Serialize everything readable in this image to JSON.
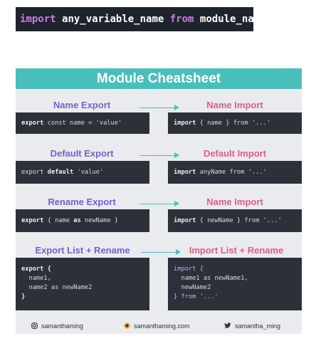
{
  "top_strip": {
    "kw1": "import",
    "var": "any_variable_name",
    "kw2": "from",
    "module": "module_name"
  },
  "sheet": {
    "title": "Module Cheatsheet",
    "rows": [
      {
        "export_label": "Name Export",
        "import_label": "Name Import",
        "export_code": [
          "export",
          " const name = 'value'"
        ],
        "import_code": [
          "import",
          " { name } from '...'"
        ]
      },
      {
        "export_label": "Default Export",
        "import_label": "Default Import",
        "export_code": [
          "export",
          " default",
          " 'value'"
        ],
        "import_code": [
          "import",
          " anyName from '...'"
        ]
      },
      {
        "export_label": "Rename Export",
        "import_label": "Name Import",
        "export_code": [
          "export",
          " { name ",
          "as",
          " newName }"
        ],
        "import_code": [
          "import",
          " { newName } from '...'"
        ]
      },
      {
        "export_label": "Export List + Rename",
        "import_label": "Import List + Rename",
        "export_lines": [
          "export {",
          "  name1,",
          "  name2 as newName2",
          "}"
        ],
        "import_lines": [
          "import {",
          "  name1 as newName1,",
          "  newName2",
          "} from '...'"
        ]
      }
    ]
  },
  "footer": {
    "instagram": "samanthaming",
    "website": "samanthaming.com",
    "twitter": "samantha_ming"
  },
  "colors": {
    "header": "#49bfbb",
    "export_label": "#7a5fc8",
    "import_label": "#e05d85",
    "code_bg": "#2c3038"
  }
}
